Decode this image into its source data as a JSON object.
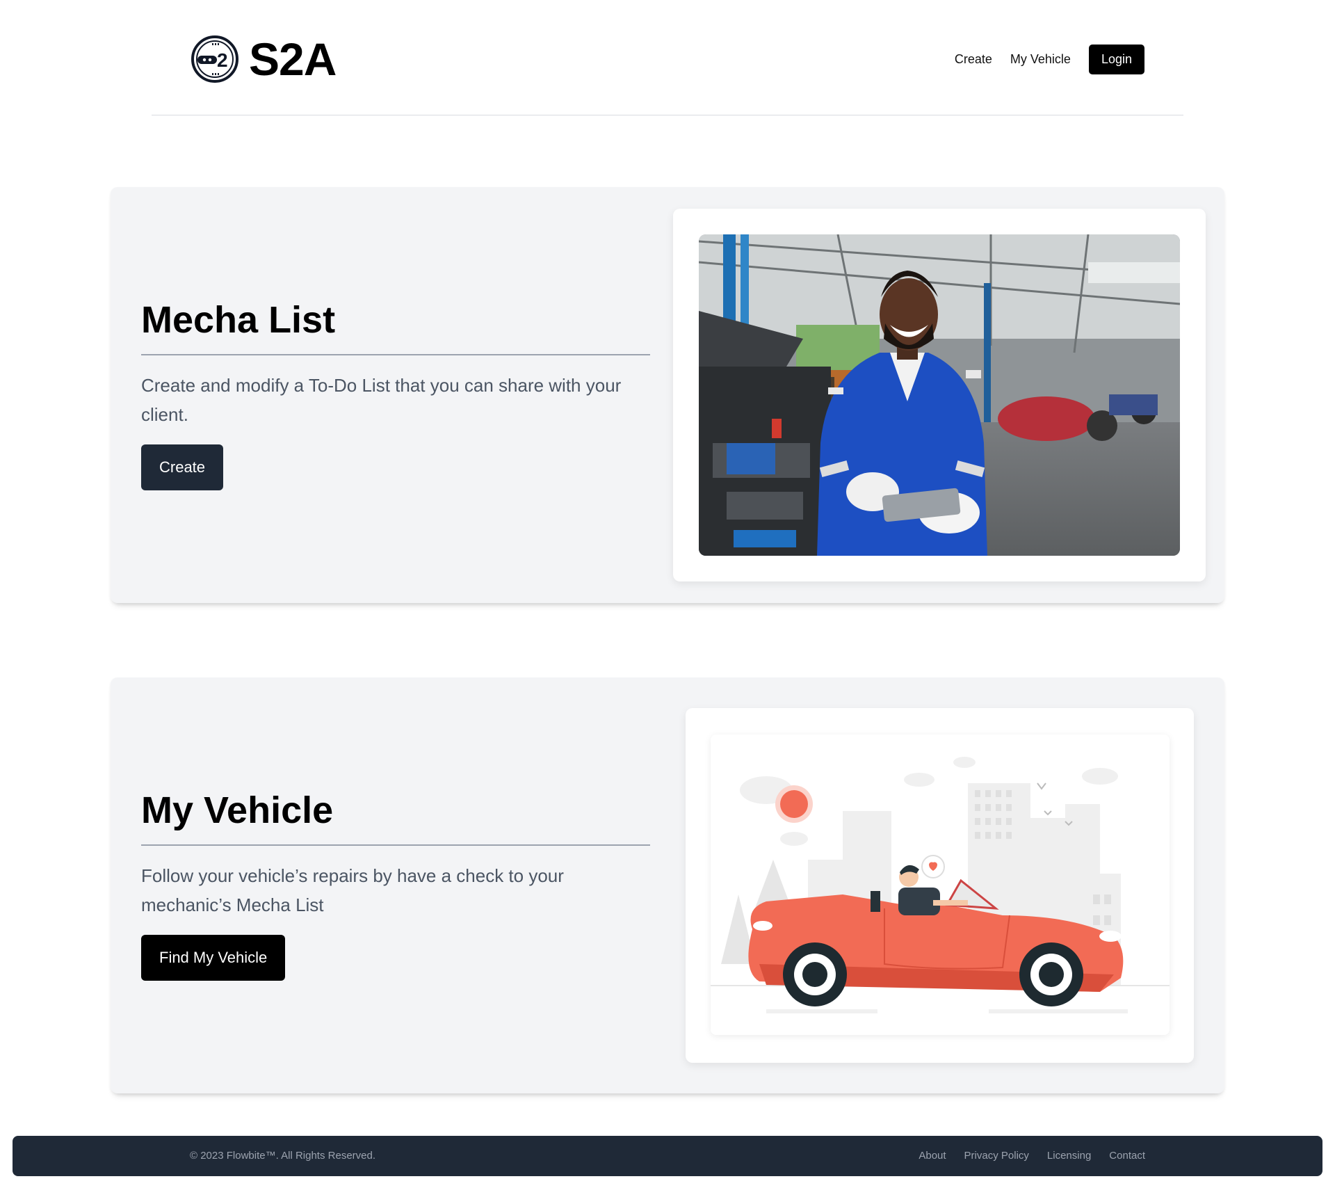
{
  "header": {
    "brand_name": "S2A",
    "logo_text": "2",
    "nav": {
      "create": "Create",
      "my_vehicle": "My Vehicle",
      "login": "Login"
    }
  },
  "sections": [
    {
      "title": "Mecha List",
      "description": "Create and modify a To-Do List that you can share with your client.",
      "button_label": "Create",
      "image": "mechanic-photo"
    },
    {
      "title": "My Vehicle",
      "description": "Follow your vehicle’s repairs by have a check to your mechanic’s Mecha List",
      "button_label": "Find My Vehicle",
      "image": "convertible-car-illustration"
    }
  ],
  "footer": {
    "copyright": "© 2023 Flowbite™. All Rights Reserved.",
    "links": [
      "About",
      "Privacy Policy",
      "Licensing",
      "Contact"
    ]
  },
  "colors": {
    "card_bg": "#f3f4f6",
    "dark_button": "#1f2937",
    "black_button": "#000000",
    "footer_bg": "#1f2937",
    "car_red": "#f26b55"
  }
}
